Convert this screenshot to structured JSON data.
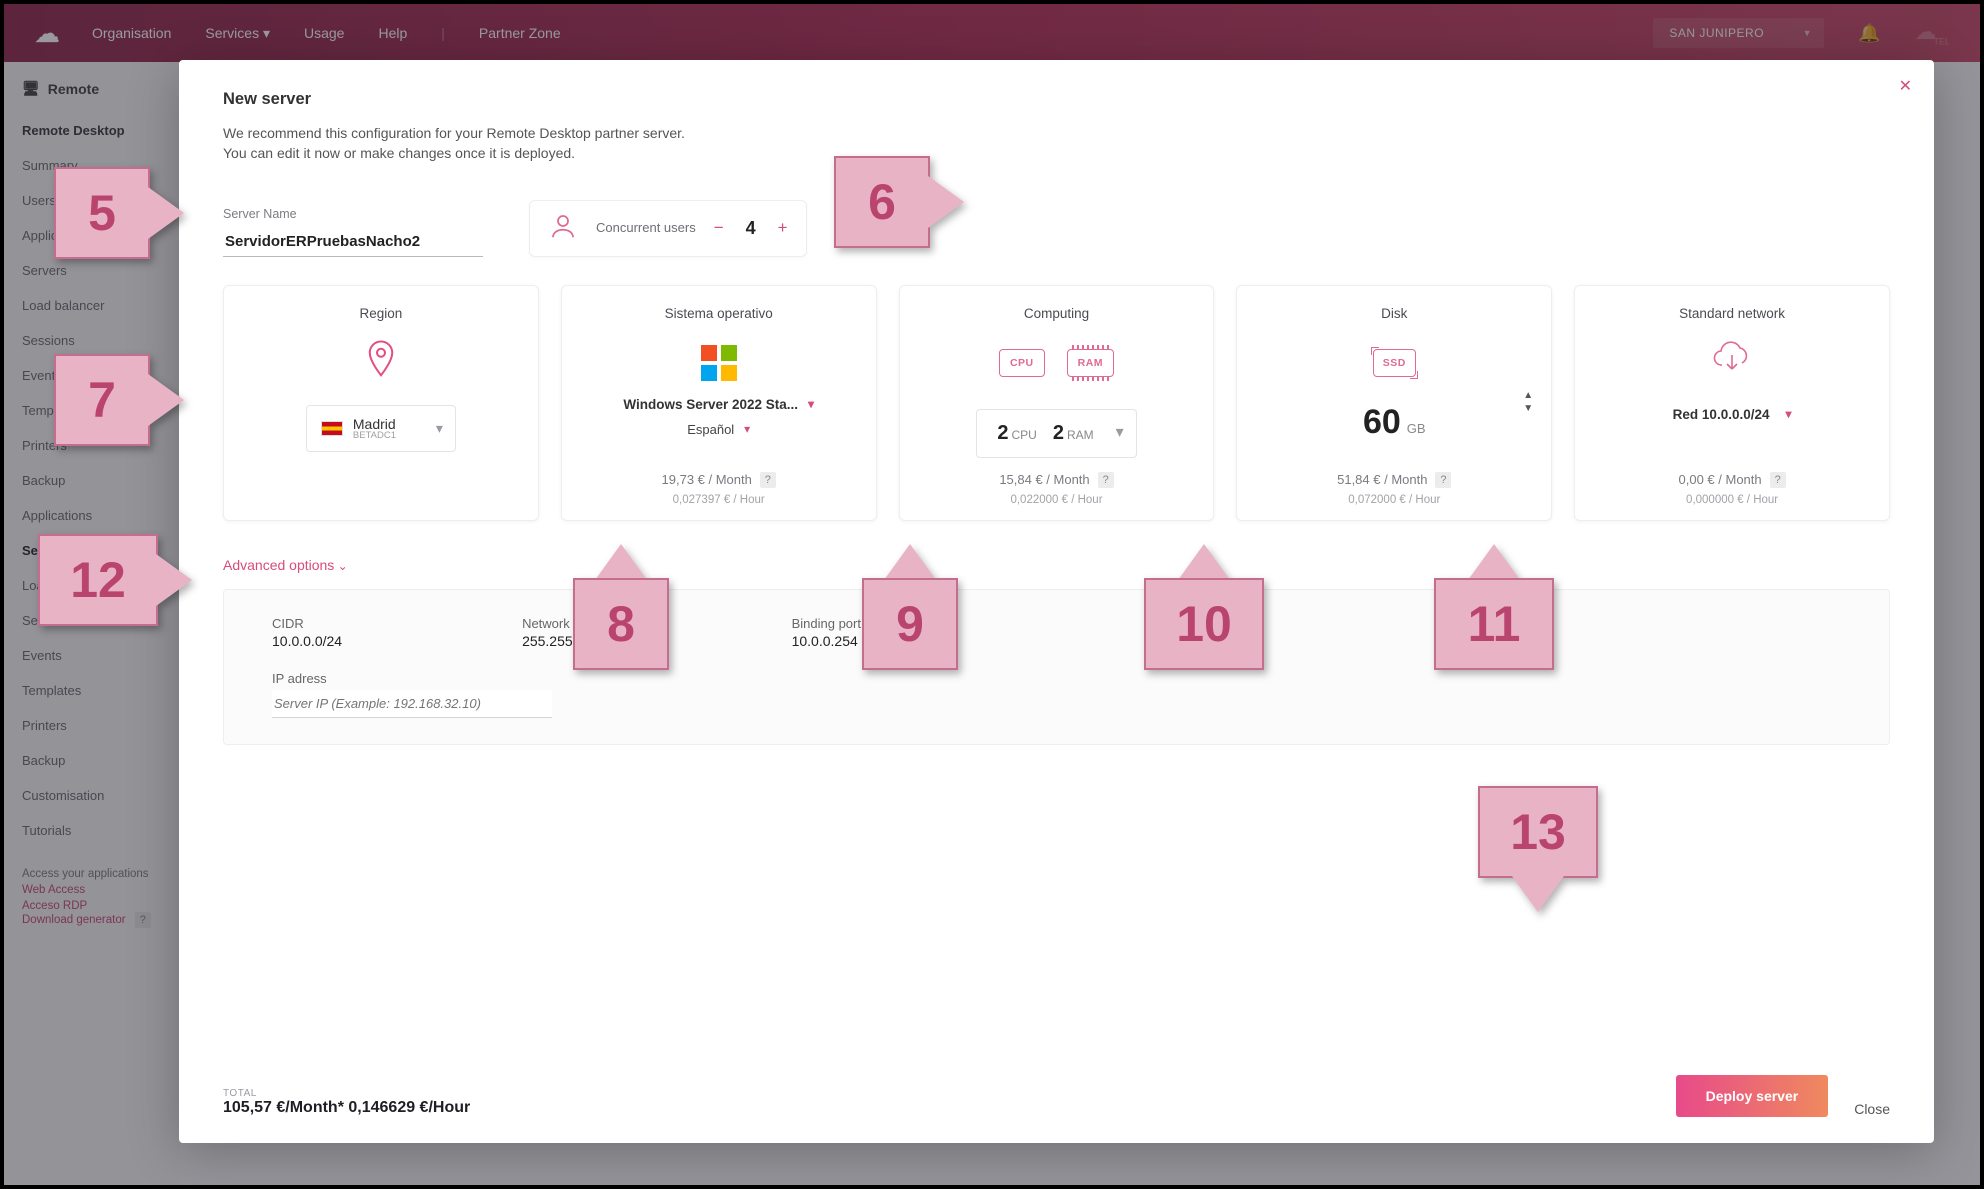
{
  "topnav": {
    "org": "Organisation",
    "services": "Services",
    "usage": "Usage",
    "help": "Help",
    "partner": "Partner Zone",
    "tenant": "SAN JUNIPERO"
  },
  "sidebar": {
    "title": "Remote",
    "section1": "Remote Desktop",
    "section2_active": "Servers",
    "items_a": [
      "Summary",
      "Users",
      "Applications",
      "Servers",
      "Load balancer",
      "Sessions",
      "Events",
      "Templates",
      "Printers",
      "Backup",
      "Applications"
    ],
    "items_b": [
      "Load balancer",
      "Sessions",
      "Events",
      "Templates",
      "Printers",
      "Backup",
      "Customisation",
      "Tutorials"
    ],
    "footer_hint": "Access your applications",
    "footer_links": [
      "Web Access",
      "Acceso RDP"
    ],
    "footer_dl": "Download generator"
  },
  "modal": {
    "title": "New server",
    "intro1": "We recommend this configuration for your Remote Desktop partner server.",
    "intro2": "You can edit it now or make changes once it is deployed.",
    "server_name_label": "Server Name",
    "server_name_value": "ServidorERPruebasNacho2",
    "concurrent_label": "Concurrent users",
    "concurrent_value": "4",
    "cards": {
      "region": {
        "title": "Region",
        "city": "Madrid",
        "dc": "BETADC1"
      },
      "os": {
        "title": "Sistema operativo",
        "name": "Windows Server 2022 Sta...",
        "lang": "Español",
        "price": "19,73 € / Month",
        "sub": "0,027397 € / Hour"
      },
      "comp": {
        "title": "Computing",
        "cpu": "2",
        "cpu_u": "CPU",
        "ram": "2",
        "ram_u": "RAM",
        "price": "15,84 € / Month",
        "sub": "0,022000 € / Hour"
      },
      "disk": {
        "title": "Disk",
        "val": "60",
        "unit": "GB",
        "price": "51,84 € / Month",
        "sub": "0,072000 € / Hour"
      },
      "net": {
        "title": "Standard network",
        "name": "Red 10.0.0.0/24",
        "price": "0,00 € / Month",
        "sub": "0,000000 € / Hour"
      }
    },
    "advanced_label": "Advanced options",
    "adv": {
      "cidr_l": "CIDR",
      "cidr_v": "10.0.0.0/24",
      "mask_l": "Network mask",
      "mask_v": "255.255.255.0",
      "bind_l": "Binding port",
      "bind_v": "10.0.0.254",
      "ip_l": "IP adress",
      "ip_ph": "Server IP (Example: 192.168.32.10)"
    },
    "total_l": "TOTAL",
    "total_v": "105,57 €/Month* 0,146629 €/Hour",
    "deploy": "Deploy server",
    "close": "Close"
  },
  "callouts": {
    "c5": "5",
    "c6": "6",
    "c7": "7",
    "c8": "8",
    "c9": "9",
    "c10": "10",
    "c11": "11",
    "c12": "12",
    "c13": "13"
  }
}
